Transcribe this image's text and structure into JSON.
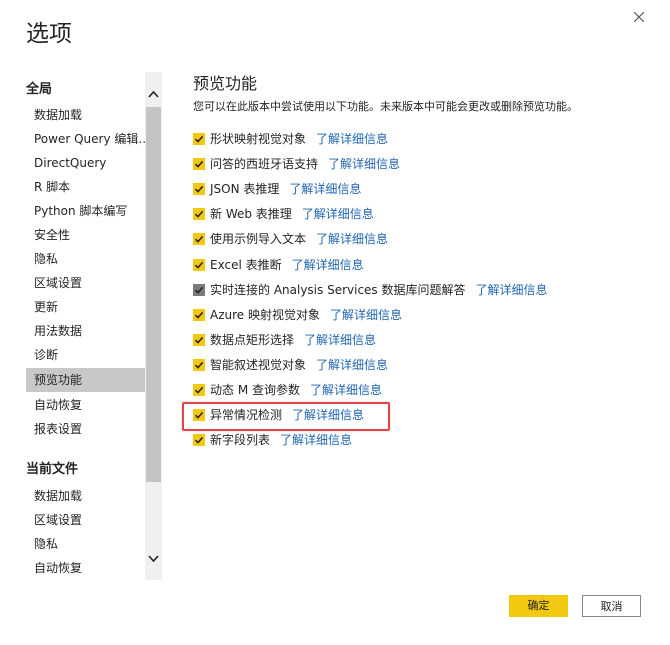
{
  "dialog": {
    "title": "选项"
  },
  "sidebar": {
    "global_heading": "全局",
    "global_items": [
      "数据加载",
      "Power Query 编辑...",
      "DirectQuery",
      "R 脚本",
      "Python 脚本编写",
      "安全性",
      "隐私",
      "区域设置",
      "更新",
      "用法数据",
      "诊断",
      "预览功能",
      "自动恢复",
      "报表设置"
    ],
    "selected_item": "预览功能",
    "current_file_heading": "当前文件",
    "current_file_items": [
      "数据加载",
      "区域设置",
      "隐私",
      "自动恢复"
    ]
  },
  "content": {
    "heading": "预览功能",
    "description": "您可以在此版本中尝试使用以下功能。未来版本中可能会更改或删除预览功能。",
    "link_label": "了解详细信息",
    "features": [
      {
        "label": "形状映射视觉对象",
        "checked": true
      },
      {
        "label": "问答的西班牙语支持",
        "checked": true
      },
      {
        "label": "JSON 表推理",
        "checked": true
      },
      {
        "label": "新 Web 表推理",
        "checked": true
      },
      {
        "label": "使用示例导入文本",
        "checked": true
      },
      {
        "label": "Excel 表推断",
        "checked": true
      },
      {
        "label": "实时连接的 Analysis Services 数据库问题解答",
        "checked": true,
        "disabled": true
      },
      {
        "label": "Azure 映射视觉对象",
        "checked": true
      },
      {
        "label": "数据点矩形选择",
        "checked": true
      },
      {
        "label": "智能叙述视觉对象",
        "checked": true
      },
      {
        "label": "动态 M 查询参数",
        "checked": true
      },
      {
        "label": "异常情况检测",
        "checked": true,
        "highlighted": true
      },
      {
        "label": "新字段列表",
        "checked": true
      }
    ]
  },
  "footer": {
    "ok_label": "确定",
    "cancel_label": "取消"
  },
  "colors": {
    "accent": "#f2c811",
    "link": "#2065b0",
    "highlight_border": "#e04545",
    "selected_bg": "#c8c8c8"
  },
  "icons": {
    "close": "close-icon",
    "scroll_up": "chevron-up-icon",
    "scroll_down": "chevron-down-icon",
    "check": "check-icon"
  }
}
